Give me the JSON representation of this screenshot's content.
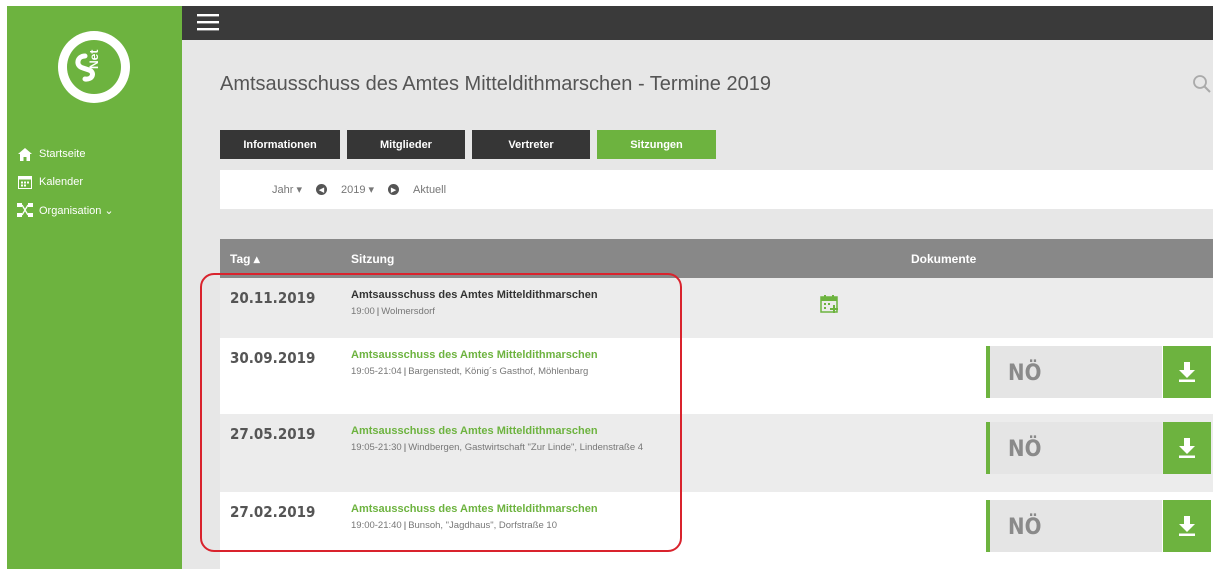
{
  "sidebar": {
    "logo_text": "S Net",
    "items": [
      {
        "label": "Startseite",
        "icon": "home-icon"
      },
      {
        "label": "Kalender",
        "icon": "calendar-icon"
      },
      {
        "label": "Organisation ⌄",
        "icon": "organisation-icon"
      }
    ]
  },
  "page": {
    "title": "Amtsausschuss des Amtes Mitteldithmarschen - Termine 2019"
  },
  "tabs": [
    {
      "label": "Informationen",
      "active": false
    },
    {
      "label": "Mitglieder",
      "active": false
    },
    {
      "label": "Vertreter",
      "active": false
    },
    {
      "label": "Sitzungen",
      "active": true
    }
  ],
  "filter": {
    "period": "Jahr ▾",
    "year": "2019 ▾",
    "current": "Aktuell"
  },
  "table": {
    "headers": {
      "day": "Tag ▴",
      "session": "Sitzung",
      "documents": "Dokumente"
    },
    "rows": [
      {
        "date": "20.11.2019",
        "title": "Amtsausschuss des Amtes Mitteldithmarschen",
        "time": "19:00",
        "place": "Wolmersdorf",
        "doc": null
      },
      {
        "date": "30.09.2019",
        "title": "Amtsausschuss des Amtes Mitteldithmarschen",
        "time": "19:05-21:04",
        "place": "Bargenstedt, König´s Gasthof, Möhlenbarg",
        "doc": "NÖ"
      },
      {
        "date": "27.05.2019",
        "title": "Amtsausschuss des Amtes Mitteldithmarschen",
        "time": "19:05-21:30",
        "place": "Windbergen, Gastwirtschaft \"Zur Linde\", Lindenstraße 4",
        "doc": "NÖ"
      },
      {
        "date": "27.02.2019",
        "title": "Amtsausschuss des Amtes Mitteldithmarschen",
        "time": "19:00-21:40",
        "place": "Bunsoh, \"Jagdhaus\", Dorfstraße 10",
        "doc": "NÖ"
      }
    ]
  },
  "colors": {
    "brand_green": "#6db33f",
    "dark": "#363636",
    "highlight": "#d9232d"
  }
}
